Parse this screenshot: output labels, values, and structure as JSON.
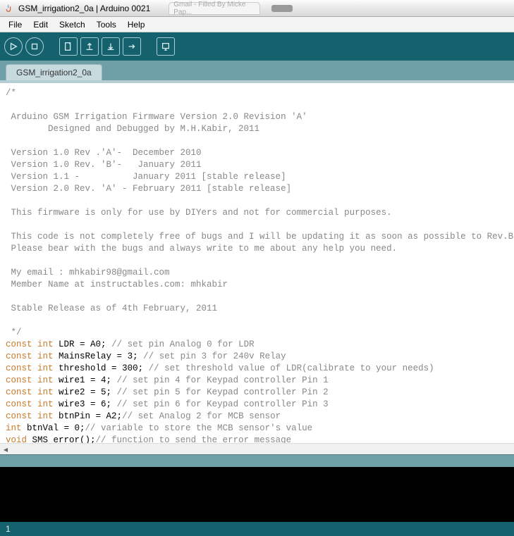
{
  "window": {
    "title": "GSM_irrigation2_0a | Arduino 0021",
    "bg_tab": "Gmail - Filled By Micke Pap..."
  },
  "menu": {
    "file": "File",
    "edit": "Edit",
    "sketch": "Sketch",
    "tools": "Tools",
    "help": "Help"
  },
  "tab": {
    "name": "GSM_irrigation2_0a"
  },
  "code": {
    "c0": "/*",
    "c1": " Arduino GSM Irrigation Firmware Version 2.0 Revision 'A'",
    "c2": "        Designed and Debugged by M.H.Kabir, 2011",
    "c3": " Version 1.0 Rev .'A'-  December 2010",
    "c4": " Version 1.0 Rev. 'B'-   January 2011",
    "c5": " Version 1.1 -          January 2011 [stable release]",
    "c6": " Version 2.0 Rev. 'A' - February 2011 [stable release]",
    "c7": " This firmware is only for use by DIYers and not for commercial purposes.",
    "c8": " This code is not completely free of bugs and I will be updating it as soon as possible to Rev.B",
    "c9": " Please bear with the bugs and always write to me about any help you need.",
    "c10": " My email : mhkabir98@gmail.com",
    "c11": " Member Name at instructables.com: mhkabir",
    "c12": " Stable Release as of 4th February, 2011",
    "c13": " */",
    "kw_const": "const",
    "kw_int": "int",
    "kw_void": "void",
    "l1a": " LDR = A0;",
    "l1c": " // set pin Analog 0 for LDR",
    "l2a": " MainsRelay = 3;",
    "l2c": " // set pin 3 for 240v Relay",
    "l3a": " threshold = 300;",
    "l3c": " // set threshold value of LDR(calibrate to your needs)",
    "l4a": " wire1 = 4;",
    "l4c": " // set pin 4 for Keypad controller Pin 1",
    "l5a": " wire2 = 5;",
    "l5c": " // set pin 5 for Keypad controller Pin 2",
    "l6a": " wire3 = 6;",
    "l6c": " // set pin 6 for Keypad controller Pin 3",
    "l7a": " btnPin = A2;",
    "l7c": "// set Analog 2 for MCB sensor",
    "l8a": " btnVal = 0;",
    "l8c": "// variable to store the MCB sensor's value",
    "l9a": " SMS_error();",
    "l9c": "// function to send the error message"
  },
  "status": {
    "line": "1"
  }
}
